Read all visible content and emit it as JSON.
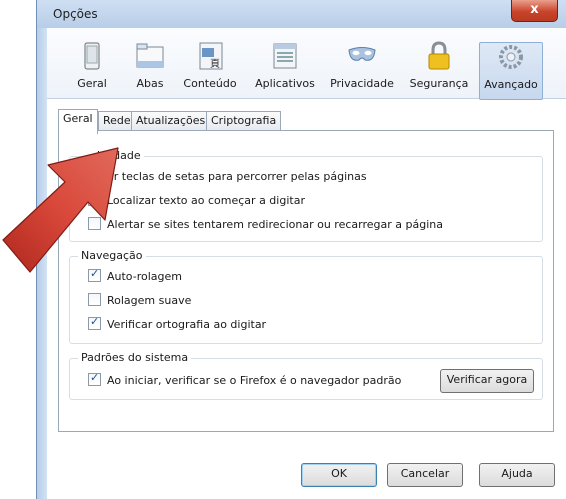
{
  "window": {
    "title": "Opções",
    "close_label": "x"
  },
  "toolbar": {
    "items": [
      {
        "label": "Geral",
        "icon": "general-icon",
        "selected": false
      },
      {
        "label": "Abas",
        "icon": "tabs-icon",
        "selected": false
      },
      {
        "label": "Conteúdo",
        "icon": "content-icon",
        "selected": false
      },
      {
        "label": "Aplicativos",
        "icon": "applications-icon",
        "selected": false
      },
      {
        "label": "Privacidade",
        "icon": "privacy-mask-icon",
        "selected": false
      },
      {
        "label": "Segurança",
        "icon": "padlock-icon",
        "selected": false
      },
      {
        "label": "Avançado",
        "icon": "gears-icon",
        "selected": true
      }
    ]
  },
  "tabs": [
    "Geral",
    "Rede",
    "Atualizações",
    "Criptografia"
  ],
  "active_tab": "Geral",
  "groups": {
    "accessibility": {
      "title_visible": "bilidade",
      "options": [
        {
          "label": "ar teclas de setas para percorrer pelas páginas",
          "checked": false
        },
        {
          "label": "Localizar texto ao começar a digitar",
          "checked": false
        },
        {
          "label": "Alertar se sites tentarem redirecionar ou recarregar a página",
          "checked": false
        }
      ]
    },
    "navigation": {
      "title": "Navegação",
      "options": [
        {
          "label": "Auto-rolagem",
          "checked": true
        },
        {
          "label": "Rolagem suave",
          "checked": false
        },
        {
          "label": "Verificar ortografia ao digitar",
          "checked": true
        }
      ]
    },
    "system": {
      "title": "Padrões do sistema",
      "option": {
        "label": "Ao iniciar, verificar se o Firefox é o navegador padrão",
        "checked": true
      },
      "button": "Verificar agora"
    }
  },
  "footer": {
    "ok": "OK",
    "cancel": "Cancelar",
    "help": "Ajuda"
  },
  "colors": {
    "arrow": "#c0392b",
    "selected_tool": "#c7d8ee",
    "title_bar": "#b7cde8"
  }
}
